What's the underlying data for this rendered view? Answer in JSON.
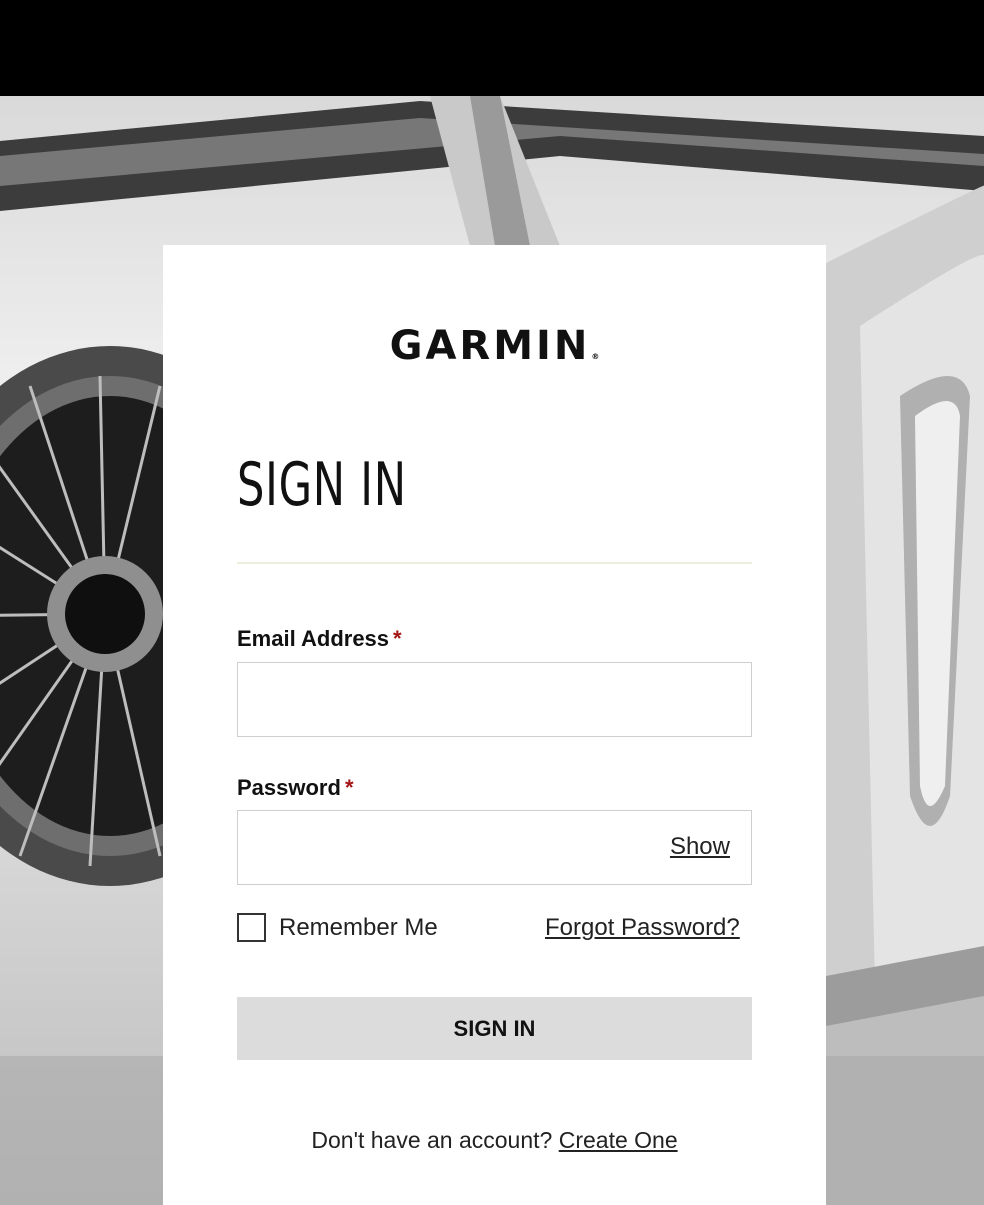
{
  "brand": {
    "logo_text": "GARMIN",
    "logo_mark": "®"
  },
  "form": {
    "title": "SIGN IN",
    "email": {
      "label": "Email Address",
      "required_mark": "*",
      "value": "",
      "placeholder": ""
    },
    "password": {
      "label": "Password",
      "required_mark": "*",
      "value": "",
      "placeholder": "",
      "show_label": "Show"
    },
    "remember": {
      "label": "Remember Me",
      "checked": false
    },
    "forgot_label": "Forgot Password?",
    "submit_label": "SIGN IN",
    "signup_prompt": "Don't have an account?",
    "signup_link": "Create One"
  },
  "colors": {
    "required": "#a41515",
    "button_bg": "#dcdcdc",
    "divider": "#eeefdc"
  }
}
